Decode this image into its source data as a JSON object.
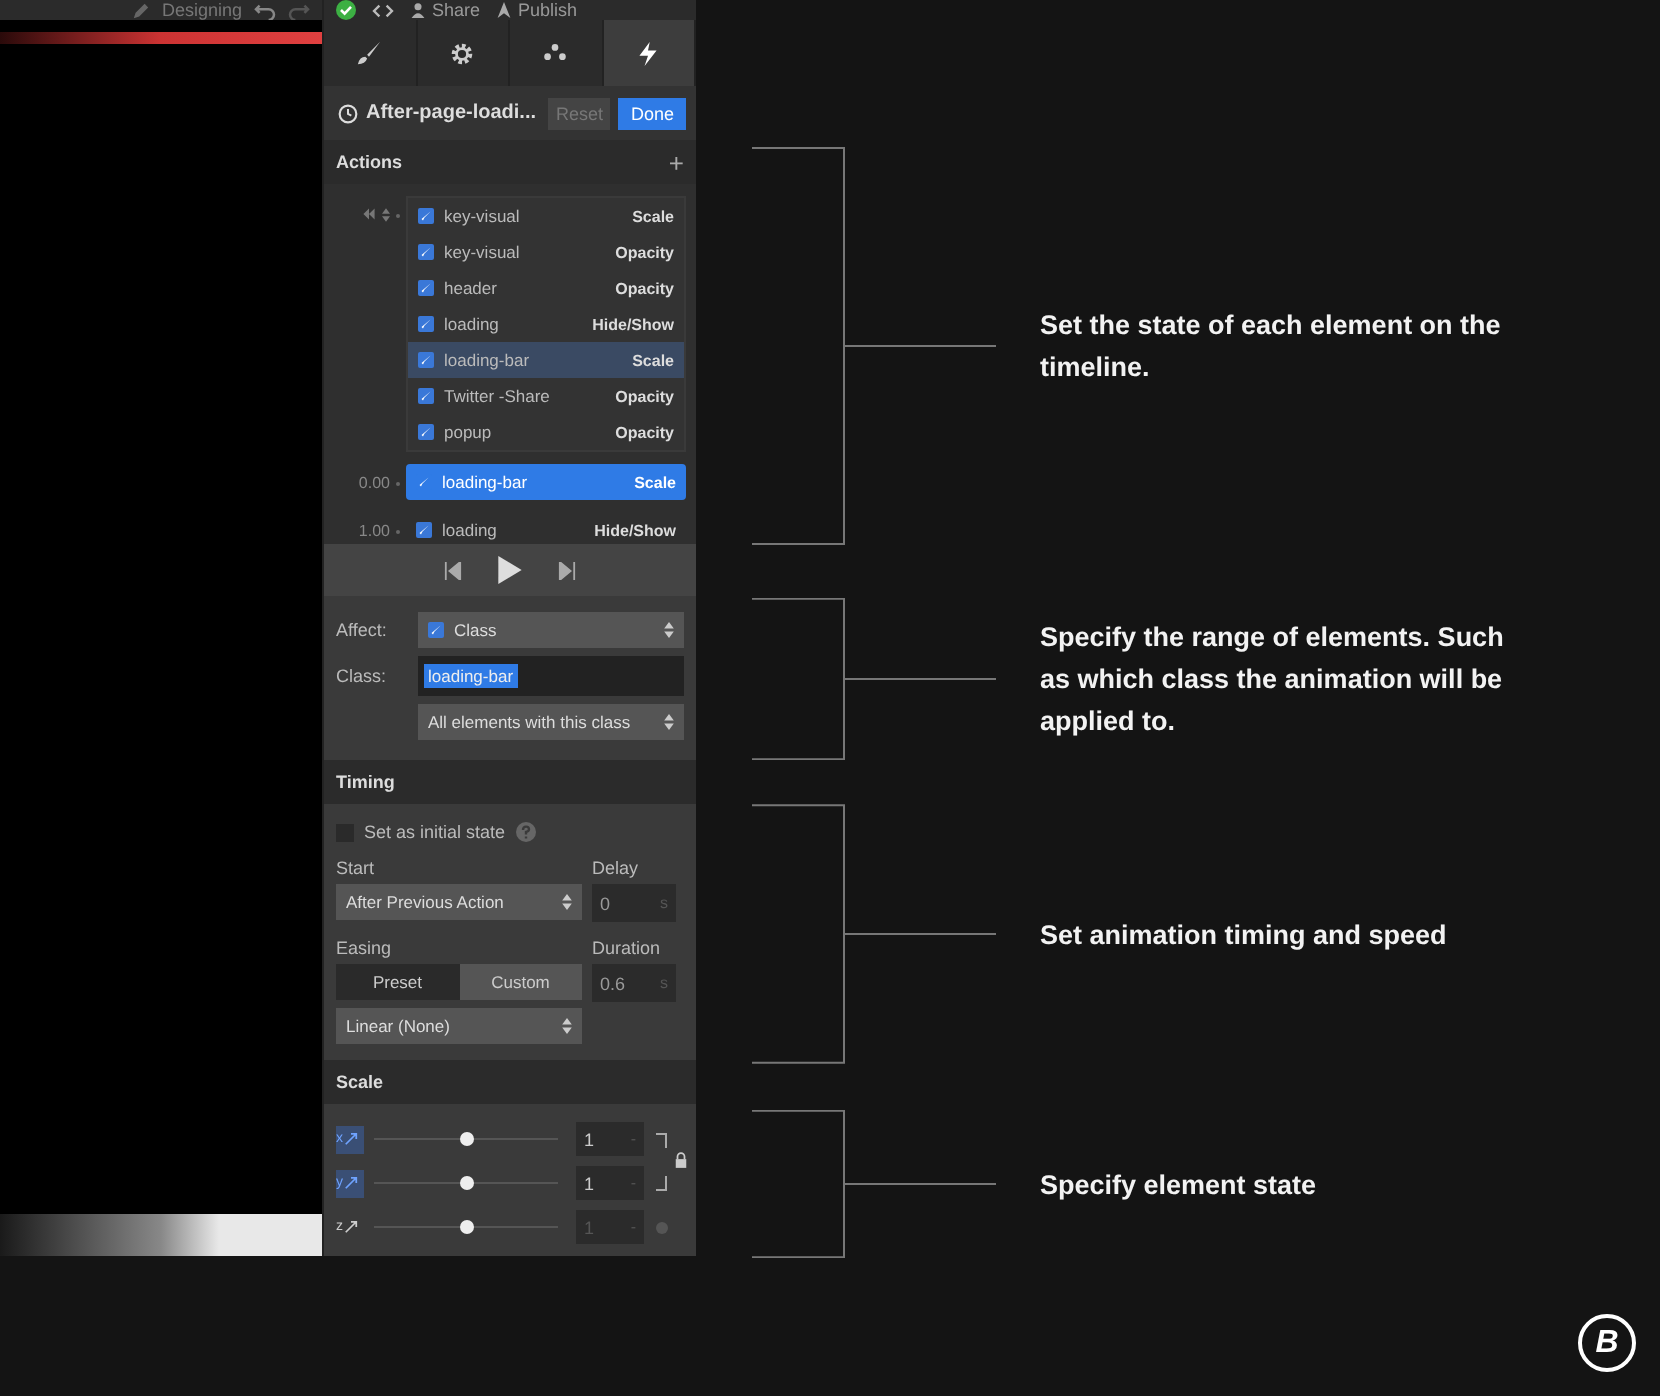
{
  "top_bar": {
    "mode": "Designing",
    "share": "Share",
    "publish": "Publish"
  },
  "panel_tabs": [
    {
      "selected": false
    },
    {
      "selected": false
    },
    {
      "selected": false
    },
    {
      "selected": true
    }
  ],
  "trigger": {
    "title": "After-page-loadi...",
    "reset": "Reset",
    "reset_disabled": true,
    "done": "Done"
  },
  "actions": {
    "title": "Actions",
    "add": "+",
    "steps": [
      {
        "kind": "initial",
        "items": [
          {
            "target": "key-visual",
            "action": "Scale",
            "checked": true,
            "selected": false,
            "highlighted": false
          },
          {
            "target": "key-visual",
            "action": "Opacity",
            "checked": true,
            "selected": false,
            "highlighted": false
          },
          {
            "target": "header",
            "action": "Opacity",
            "checked": true,
            "selected": false,
            "highlighted": false
          },
          {
            "target": "loading",
            "action": "Hide/Show",
            "checked": true,
            "selected": false,
            "highlighted": false
          },
          {
            "target": "loading-bar",
            "action": "Scale",
            "checked": true,
            "selected": false,
            "highlighted": true
          },
          {
            "target": "Twitter -Share",
            "action": "Opacity",
            "checked": true,
            "selected": false,
            "highlighted": false
          },
          {
            "target": "popup",
            "action": "Opacity",
            "checked": true,
            "selected": false,
            "highlighted": false
          }
        ]
      },
      {
        "kind": "timed",
        "time": "0.00",
        "items": [
          {
            "target": "loading-bar",
            "action": "Scale",
            "checked": true,
            "selected": true,
            "highlighted": false
          }
        ]
      },
      {
        "kind": "timed",
        "time": "1.00",
        "items": [
          {
            "target": "loading",
            "action": "Hide/Show",
            "checked": true,
            "selected": false,
            "highlighted": false
          }
        ]
      }
    ]
  },
  "affect": {
    "label": "Affect:",
    "value": "Class",
    "class_label": "Class:",
    "class_tag": "loading-bar",
    "scope": "All elements with this class"
  },
  "timing": {
    "title": "Timing",
    "initial_state": {
      "label": "Set as initial state",
      "checked": false
    },
    "start_label": "Start",
    "start": "After Previous Action",
    "delay_label": "Delay",
    "delay": "0",
    "delay_unit": "s",
    "easing_label": "Easing",
    "easing_tabs": [
      {
        "label": "Preset",
        "selected": false
      },
      {
        "label": "Custom",
        "selected": true
      }
    ],
    "duration_label": "Duration",
    "duration": "0.6",
    "duration_unit": "s",
    "curve": "Linear (None)"
  },
  "scale": {
    "title": "Scale",
    "rows": [
      {
        "axis": "x",
        "active": true,
        "level": 0.5,
        "value": "1",
        "unit": "-",
        "disabled": false
      },
      {
        "axis": "y",
        "active": true,
        "level": 0.5,
        "value": "1",
        "unit": "-",
        "disabled": false
      },
      {
        "axis": "z",
        "active": false,
        "level": 0.5,
        "value": "1",
        "unit": "-",
        "disabled": true
      }
    ]
  },
  "annotations": [
    {
      "text": "Set the state of each element on the timeline."
    },
    {
      "text": "Specify the range of elements. Such as which class the animation will be applied to."
    },
    {
      "text": "Set animation timing and speed"
    },
    {
      "text": "Specify element state"
    }
  ],
  "logo": {
    "letter": "B"
  }
}
